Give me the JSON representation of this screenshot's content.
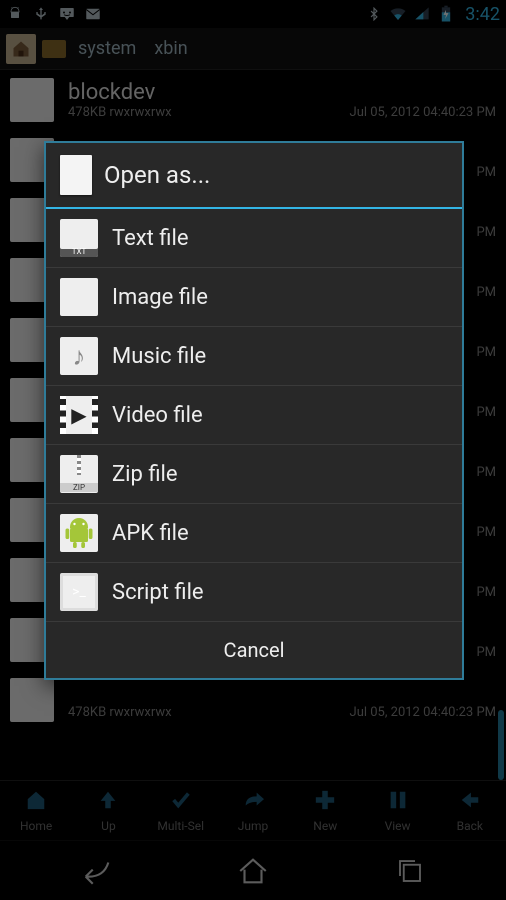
{
  "statusbar": {
    "clock": "3:42",
    "icons_left": [
      "android",
      "usb",
      "chat",
      "mail"
    ],
    "icons_right": [
      "bluetooth",
      "wifi",
      "signal",
      "battery"
    ]
  },
  "pathbar": {
    "segments": [
      "system",
      "xbin"
    ]
  },
  "filelist": {
    "visible_name_top": "blockdev",
    "size_perm": "478KB rwxrwxrwx",
    "date": "Jul 05, 2012 04:40:23 PM",
    "pm_suffix": "PM"
  },
  "dialog": {
    "title": "Open as...",
    "items": [
      {
        "label": "Text file",
        "icon": "text"
      },
      {
        "label": "Image file",
        "icon": "image"
      },
      {
        "label": "Music file",
        "icon": "music"
      },
      {
        "label": "Video file",
        "icon": "video"
      },
      {
        "label": "Zip file",
        "icon": "zip"
      },
      {
        "label": "APK file",
        "icon": "apk"
      },
      {
        "label": "Script file",
        "icon": "script"
      }
    ],
    "cancel": "Cancel"
  },
  "toolbar": {
    "items": [
      {
        "label": "Home"
      },
      {
        "label": "Up"
      },
      {
        "label": "Multi-Sel"
      },
      {
        "label": "Jump"
      },
      {
        "label": "New"
      },
      {
        "label": "View"
      },
      {
        "label": "Back"
      }
    ]
  }
}
